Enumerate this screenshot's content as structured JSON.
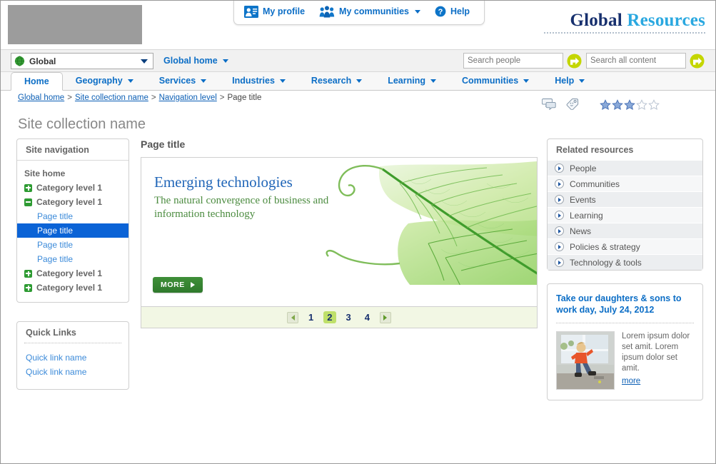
{
  "utility": {
    "items": [
      {
        "label": "My profile",
        "icon": "profile-card-icon",
        "caret": false
      },
      {
        "label": "My communities",
        "icon": "community-people-icon",
        "caret": true
      },
      {
        "label": "Help",
        "icon": "help-question-icon",
        "caret": false
      }
    ]
  },
  "brand": {
    "word1": "Global",
    "word2": "Resources"
  },
  "scopebar": {
    "scope_value": "Global",
    "scope_icon": "globe-icon",
    "global_home_label": "Global home",
    "search_people": {
      "placeholder": "Search people",
      "value": "",
      "go_icon": "arrow-go-icon"
    },
    "search_all": {
      "placeholder": "Search all content",
      "value": "",
      "go_icon": "arrow-go-icon"
    }
  },
  "tabs": [
    {
      "label": "Home",
      "caret": false,
      "active": true
    },
    {
      "label": "Geography",
      "caret": true,
      "active": false
    },
    {
      "label": "Services",
      "caret": true,
      "active": false
    },
    {
      "label": "Industries",
      "caret": true,
      "active": false
    },
    {
      "label": "Research",
      "caret": true,
      "active": false
    },
    {
      "label": "Learning",
      "caret": true,
      "active": false
    },
    {
      "label": "Communities",
      "caret": true,
      "active": false
    },
    {
      "label": "Help",
      "caret": true,
      "active": false
    }
  ],
  "breadcrumb": {
    "items": [
      "Global home",
      "Site collection name",
      "Navigation level"
    ],
    "current": "Page title",
    "separator": ">"
  },
  "page_actions": {
    "comment_icon": "speech-bubble-icon",
    "tag_icon": "tag-icon",
    "rating": {
      "filled": 3,
      "total": 5
    }
  },
  "page_heading": "Site collection name",
  "sidebar": {
    "site_nav": {
      "title": "Site navigation",
      "home_label": "Site home",
      "items": [
        {
          "type": "category",
          "label": "Category level 1",
          "state": "plus"
        },
        {
          "type": "category",
          "label": "Category level 1",
          "state": "minus"
        },
        {
          "type": "page",
          "label": "Page title",
          "current": false
        },
        {
          "type": "page",
          "label": "Page title",
          "current": true
        },
        {
          "type": "page",
          "label": "Page title",
          "current": false
        },
        {
          "type": "page",
          "label": "Page title",
          "current": false
        },
        {
          "type": "category",
          "label": "Category level 1",
          "state": "plus"
        },
        {
          "type": "category",
          "label": "Category level 1",
          "state": "plus"
        }
      ]
    },
    "quick_links": {
      "title": "Quick Links",
      "links": [
        "Quick link name",
        "Quick link name"
      ]
    }
  },
  "main": {
    "title": "Page title",
    "banner": {
      "headline": "Emerging technologies",
      "subhead": "The natural convergence of business and information technology",
      "more_label": "MORE",
      "image_alt": "green-leaf-image"
    },
    "pager": {
      "prev_icon": "arrow-left-icon",
      "next_icon": "arrow-right-icon",
      "pages": [
        "1",
        "2",
        "3",
        "4"
      ],
      "active": "2"
    }
  },
  "related": {
    "title": "Related resources",
    "items": [
      "People",
      "Communities",
      "Events",
      "Learning",
      "News",
      "Policies & strategy",
      "Technology & tools"
    ]
  },
  "promo": {
    "title": "Take our daughters & sons to work day, July 24, 2012",
    "body": "Lorem ipsum dolor set amit. Lorem ipsum dolor set amit.",
    "more_label": "more",
    "photo_alt": "child-by-window-photo"
  },
  "colors": {
    "link_blue": "#0c6ec6",
    "brand_dark": "#17306e",
    "brand_light": "#2aa8e0",
    "green_button": "#2f7a2c",
    "pager_highlight": "#bfe06a",
    "nav_selected": "#0b63d6"
  }
}
